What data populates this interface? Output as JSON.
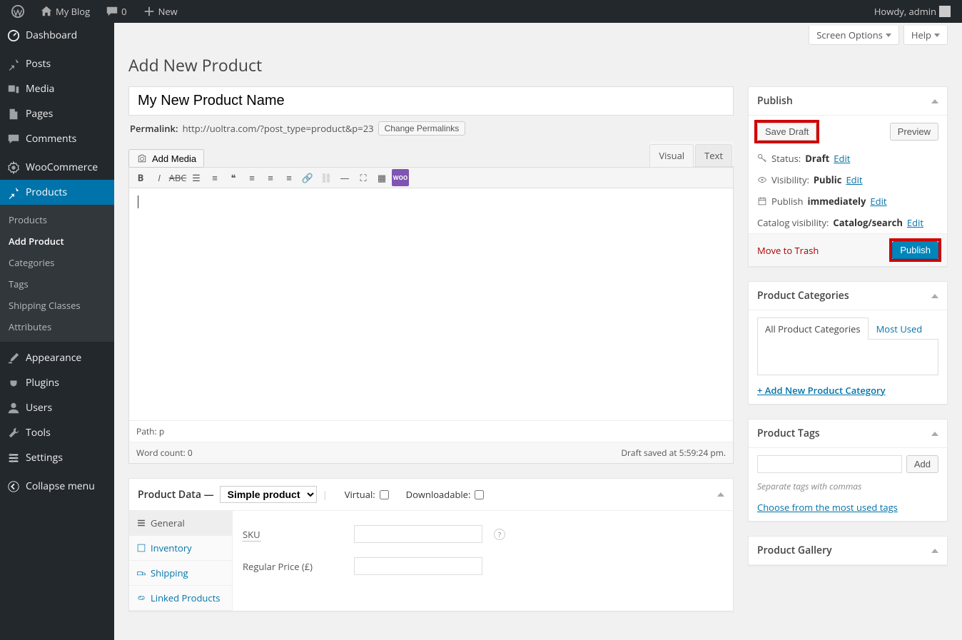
{
  "adminbar": {
    "site_name": "My Blog",
    "comments_count": "0",
    "new_label": "New",
    "howdy": "Howdy, admin"
  },
  "sidebar": {
    "items": [
      {
        "label": "Dashboard"
      },
      {
        "label": "Posts"
      },
      {
        "label": "Media"
      },
      {
        "label": "Pages"
      },
      {
        "label": "Comments"
      },
      {
        "label": "WooCommerce"
      },
      {
        "label": "Products"
      },
      {
        "label": "Appearance"
      },
      {
        "label": "Plugins"
      },
      {
        "label": "Users"
      },
      {
        "label": "Tools"
      },
      {
        "label": "Settings"
      }
    ],
    "submenu": [
      "Products",
      "Add Product",
      "Categories",
      "Tags",
      "Shipping Classes",
      "Attributes"
    ],
    "collapse": "Collapse menu"
  },
  "top": {
    "screen_options": "Screen Options",
    "help": "Help"
  },
  "page": {
    "title": "Add New Product"
  },
  "editor": {
    "title_value": "My New Product Name",
    "permalink_label": "Permalink:",
    "permalink_url": "http://uoltra.com/?post_type=product&p=23",
    "change_permalinks": "Change Permalinks",
    "add_media": "Add Media",
    "tab_visual": "Visual",
    "tab_text": "Text",
    "path_label": "Path:",
    "path_value": "p",
    "word_count": "Word count: 0",
    "draft_saved": "Draft saved at 5:59:24 pm."
  },
  "publish": {
    "title": "Publish",
    "save_draft": "Save Draft",
    "preview": "Preview",
    "status_label": "Status:",
    "status_value": "Draft",
    "visibility_label": "Visibility:",
    "visibility_value": "Public",
    "publish_label": "Publish",
    "publish_value": "immediately",
    "catalog_label": "Catalog visibility:",
    "catalog_value": "Catalog/search",
    "edit": "Edit",
    "trash": "Move to Trash",
    "publish_btn": "Publish"
  },
  "categories": {
    "title": "Product Categories",
    "tab_all": "All Product Categories",
    "tab_most": "Most Used",
    "add_new": "+ Add New Product Category"
  },
  "tags": {
    "title": "Product Tags",
    "add": "Add",
    "help": "Separate tags with commas",
    "choose": "Choose from the most used tags"
  },
  "gallery": {
    "title": "Product Gallery"
  },
  "product_data": {
    "title": "Product Data —",
    "type": "Simple product",
    "virtual": "Virtual:",
    "downloadable": "Downloadable:",
    "tabs": [
      "General",
      "Inventory",
      "Shipping",
      "Linked Products"
    ],
    "sku_label": "SKU",
    "price_label": "Regular Price (£)"
  }
}
